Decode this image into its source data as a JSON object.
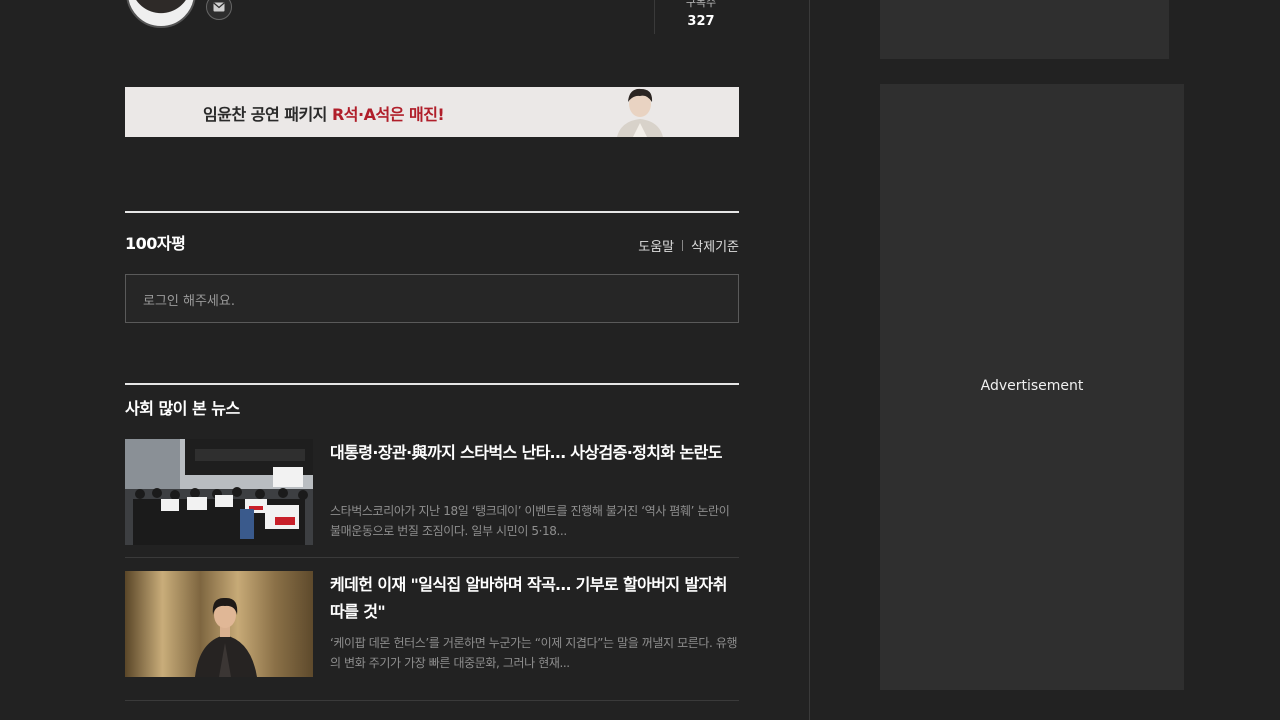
{
  "author": {
    "subscriber_label": "구독수",
    "subscriber_count": "327"
  },
  "banner": {
    "text_main": "임윤찬 공연 패키지 ",
    "text_highlight": "R석·A석은 매진!"
  },
  "comments": {
    "title": "100자평",
    "help_link": "도움말",
    "policy_link": "삭제기준",
    "login_placeholder": "로그인 해주세요."
  },
  "popular": {
    "title": "사회 많이 본 뉴스",
    "items": [
      {
        "headline": "대통령·장관·與까지 스타벅스 난타… 사상검증·정치화 논란도",
        "summary": "스타벅스코리아가 지난 18일 ‘탱크데이’ 이벤트를 진행해 불거진 ‘역사 폄훼’ 논란이 불매운동으로 번질 조짐이다. 일부 시민이 5·18..."
      },
      {
        "headline": "케데헌 이재 \"일식집 알바하며 작곡… 기부로 할아버지 발자취 따를 것\"",
        "summary": "‘케이팝 데몬 헌터스’를 거론하면 누군가는 “이제 지겹다”는 말을 꺼낼지 모른다. 유행의 변화 주기가 가장 빠른 대중문화, 그러나 현재..."
      }
    ]
  },
  "ads": {
    "label": "Advertisement"
  },
  "colors": {
    "background": "#222222",
    "panel": "#2f2f2f",
    "banner_highlight": "#b01e2a"
  }
}
